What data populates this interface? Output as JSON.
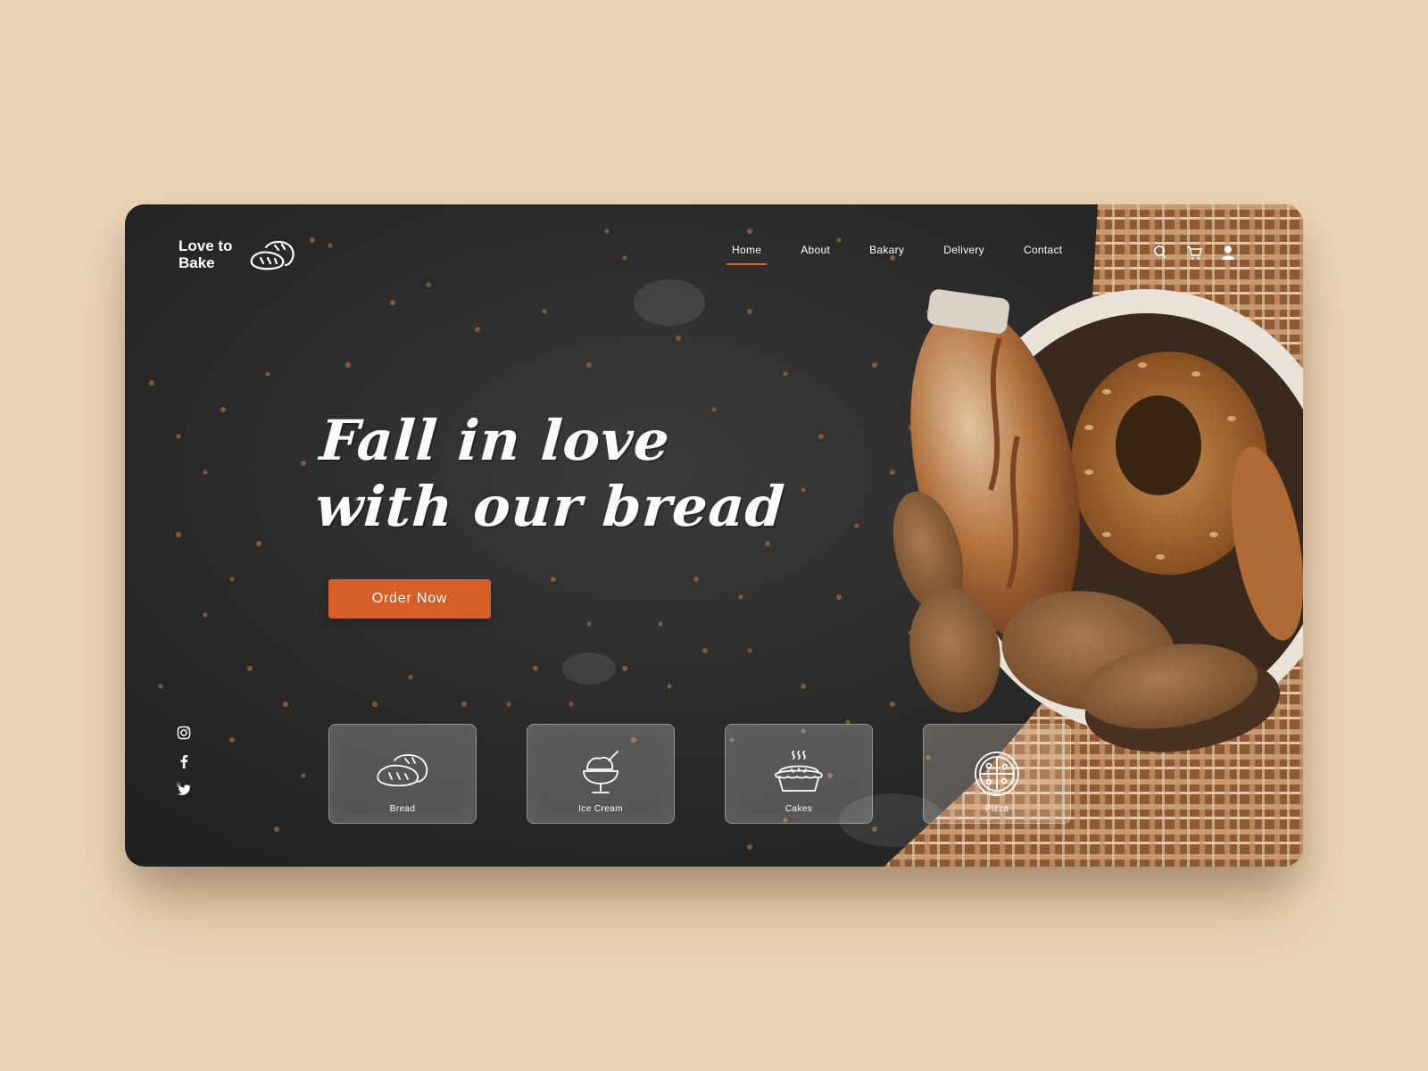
{
  "brand": {
    "line1": "Love to",
    "line2": "Bake",
    "icon": "bread-icon"
  },
  "nav": {
    "items": [
      {
        "label": "Home",
        "active": true
      },
      {
        "label": "About"
      },
      {
        "label": "Bakary"
      },
      {
        "label": "Delivery"
      },
      {
        "label": "Contact"
      }
    ],
    "icons": [
      "search-icon",
      "cart-icon",
      "user-icon"
    ]
  },
  "hero": {
    "headline_line1": "Fall in love",
    "headline_line2": "with our bread",
    "cta": "Order Now"
  },
  "social": [
    "instagram-icon",
    "facebook-icon",
    "twitter-icon"
  ],
  "categories": [
    {
      "label": "Bread",
      "icon": "bread-icon"
    },
    {
      "label": "Ice Cream",
      "icon": "ice-cream-icon"
    },
    {
      "label": "Cakes",
      "icon": "pie-icon"
    },
    {
      "label": "Pizza",
      "icon": "pizza-icon"
    }
  ],
  "colors": {
    "accent": "#d65e27",
    "page_bg": "#ecd3b3",
    "card_bg": "#2b2b2b"
  }
}
